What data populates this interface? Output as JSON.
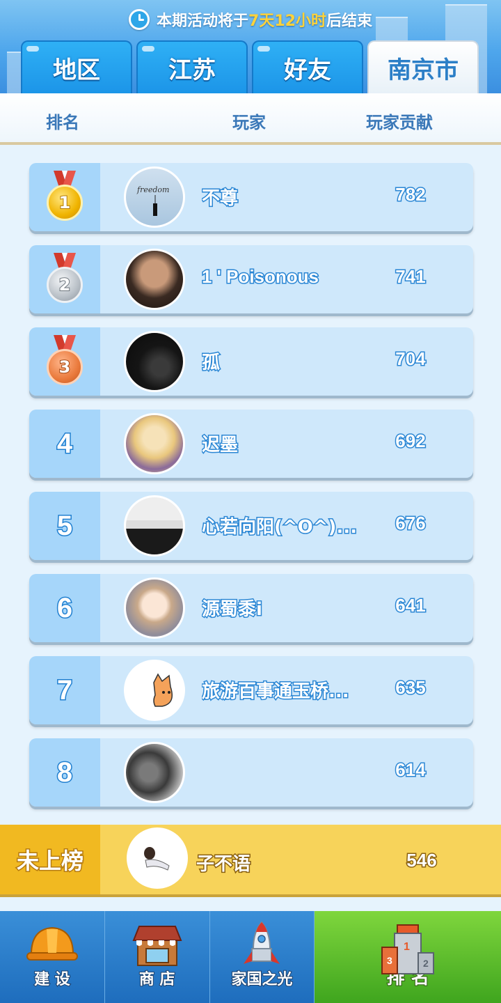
{
  "banner": {
    "prefix": "本期活动将于",
    "highlight": "7天12小时",
    "suffix": "后结束"
  },
  "tabs": [
    {
      "label": "地区",
      "active": false
    },
    {
      "label": "江苏",
      "active": false
    },
    {
      "label": "好友",
      "active": false
    },
    {
      "label": "南京市",
      "active": true
    }
  ],
  "columns": {
    "rank": "排名",
    "player": "玩家",
    "contribution": "玩家贡献"
  },
  "rows": [
    {
      "rank": "1",
      "name": "不尊",
      "score": "782",
      "medal": "gold",
      "avatar": "freedom-avatar"
    },
    {
      "rank": "2",
      "name": "1 ' Poisonous",
      "score": "741",
      "medal": "silver",
      "avatar": "man-avatar"
    },
    {
      "rank": "3",
      "name": "孤",
      "score": "704",
      "medal": "bronze",
      "avatar": "night-avatar"
    },
    {
      "rank": "4",
      "name": "迟墨",
      "score": "692",
      "avatar": "anime-avatar"
    },
    {
      "rank": "5",
      "name": "心若向阳(^O^)...",
      "score": "676",
      "avatar": "suit-avatar"
    },
    {
      "rank": "6",
      "name": "源蜀黍i",
      "score": "641",
      "avatar": "cartoon-avatar"
    },
    {
      "rank": "7",
      "name": "旅游百事通玉桥...",
      "score": "635",
      "avatar": "cat-avatar"
    },
    {
      "rank": "8",
      "name": "",
      "score": "614",
      "avatar": "bw-avatar"
    }
  ],
  "my_rank": {
    "label": "未上榜",
    "name": "子不语",
    "score": "546"
  },
  "bottom_nav": [
    {
      "label": "建 设",
      "icon": "helmet-icon",
      "active": false
    },
    {
      "label": "商 店",
      "icon": "shop-icon",
      "active": false
    },
    {
      "label": "家国之光",
      "icon": "rocket-icon",
      "active": false
    },
    {
      "label": "排 名",
      "icon": "podium-icon",
      "active": true
    }
  ],
  "colors": {
    "tab_blue": "#1c95e8",
    "row_bg": "#cfe8fb",
    "my_row": "#f7d35a",
    "highlight": "#ffd23a",
    "nav_active": "#4fb626"
  }
}
